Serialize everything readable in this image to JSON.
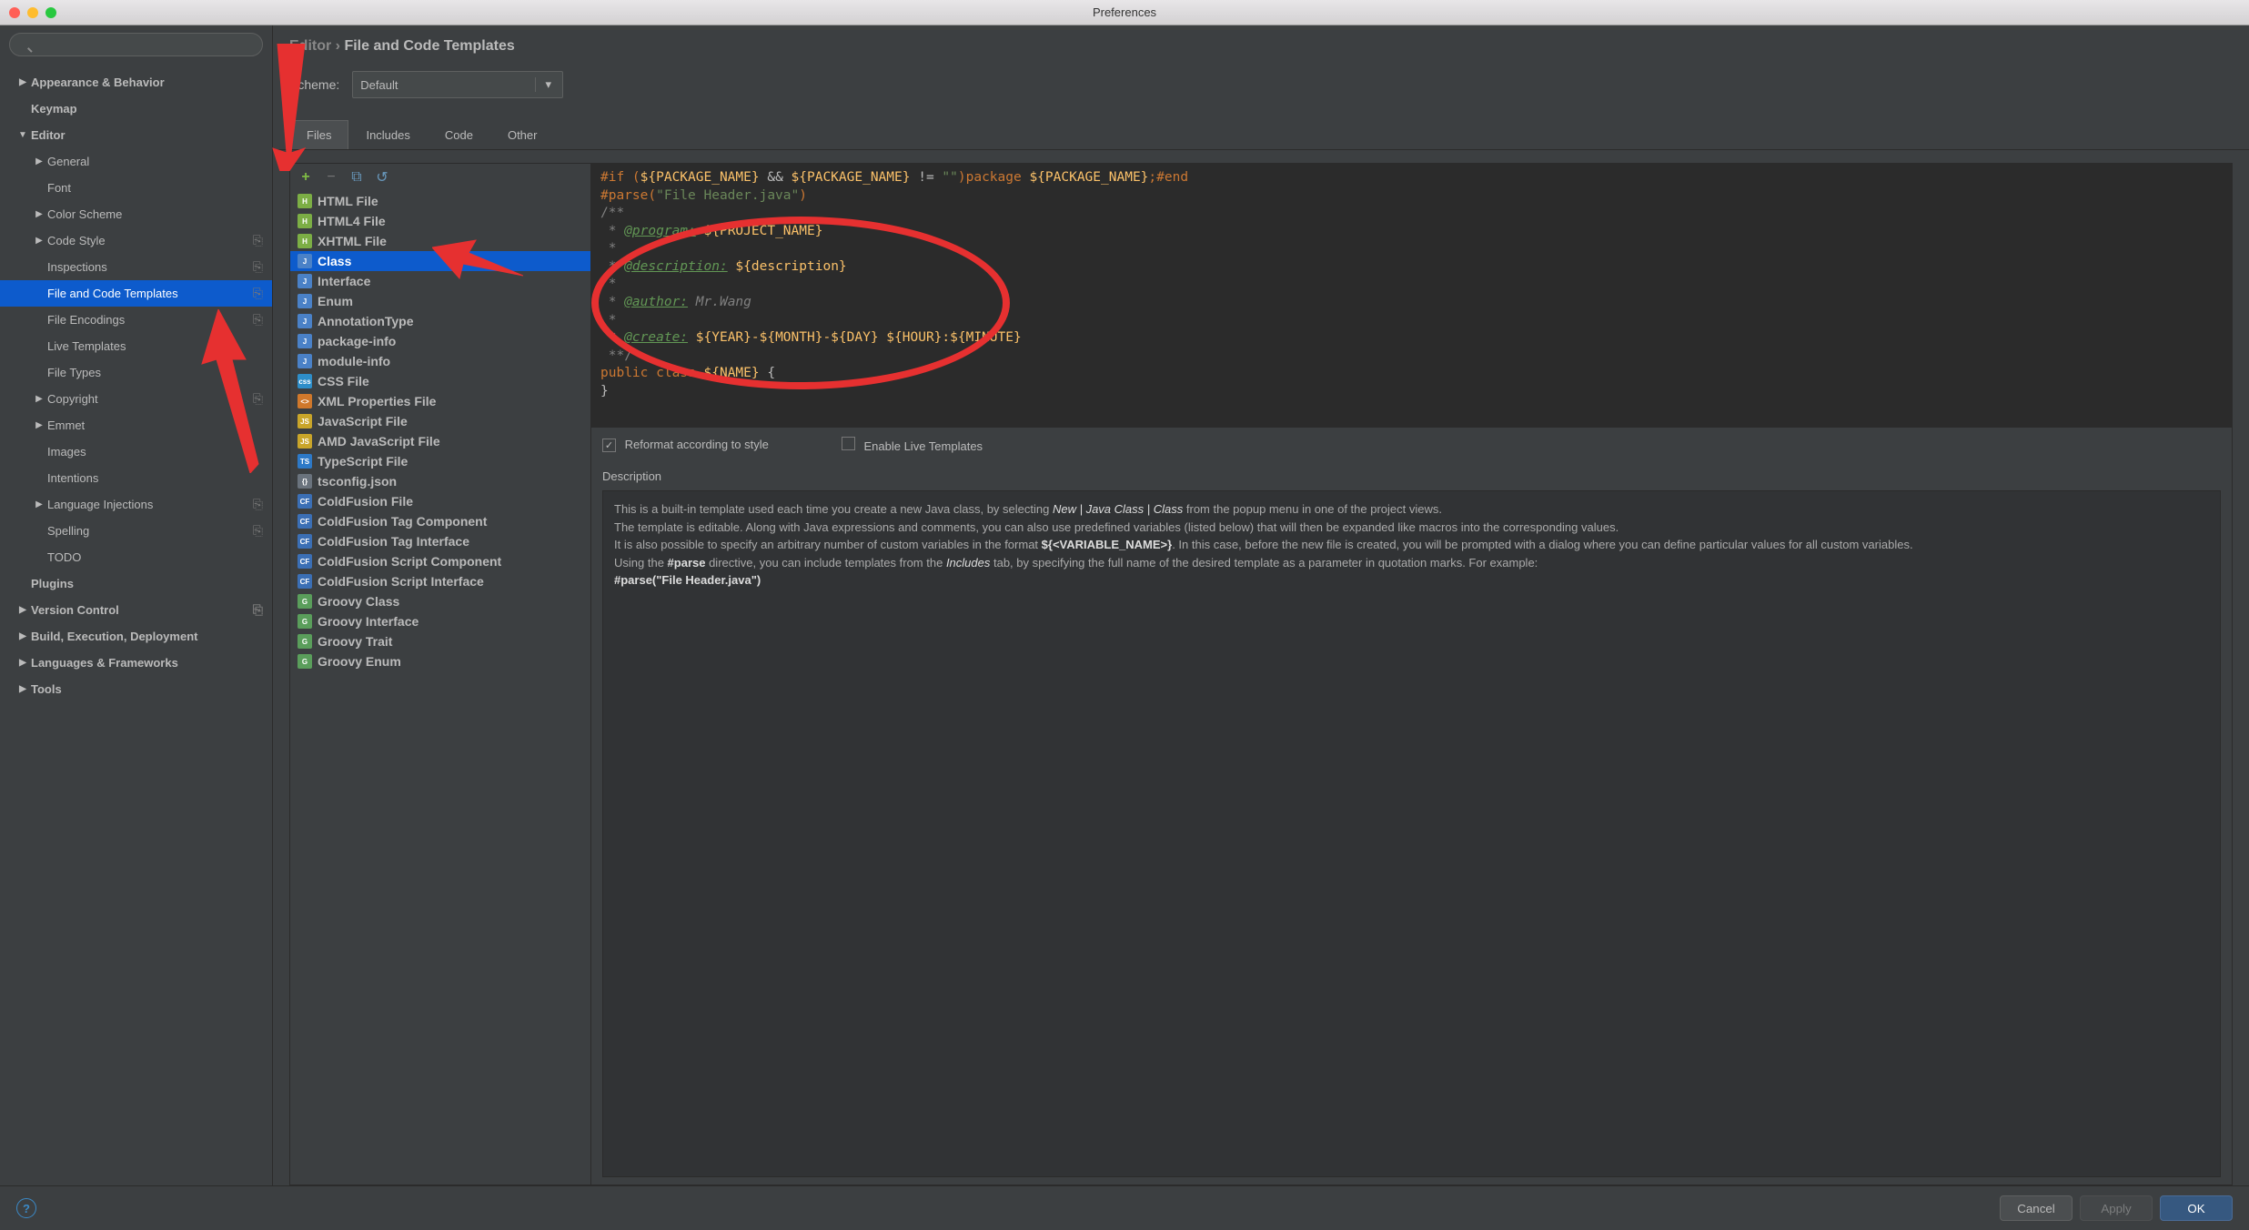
{
  "title": "Preferences",
  "sidebar": {
    "items": [
      {
        "label": "Appearance & Behavior",
        "arrow": "▶",
        "bold": true,
        "depth": 0
      },
      {
        "label": "Keymap",
        "arrow": "",
        "bold": true,
        "depth": 0
      },
      {
        "label": "Editor",
        "arrow": "▼",
        "bold": true,
        "depth": 0
      },
      {
        "label": "General",
        "arrow": "▶",
        "bold": false,
        "depth": 1
      },
      {
        "label": "Font",
        "arrow": "",
        "bold": false,
        "depth": 1
      },
      {
        "label": "Color Scheme",
        "arrow": "▶",
        "bold": false,
        "depth": 1
      },
      {
        "label": "Code Style",
        "arrow": "▶",
        "bold": false,
        "depth": 1,
        "badge": "⎘"
      },
      {
        "label": "Inspections",
        "arrow": "",
        "bold": false,
        "depth": 1,
        "badge": "⎘"
      },
      {
        "label": "File and Code Templates",
        "arrow": "",
        "bold": false,
        "depth": 1,
        "badge": "⎘",
        "selected": true
      },
      {
        "label": "File Encodings",
        "arrow": "",
        "bold": false,
        "depth": 1,
        "badge": "⎘"
      },
      {
        "label": "Live Templates",
        "arrow": "",
        "bold": false,
        "depth": 1
      },
      {
        "label": "File Types",
        "arrow": "",
        "bold": false,
        "depth": 1
      },
      {
        "label": "Copyright",
        "arrow": "▶",
        "bold": false,
        "depth": 1,
        "badge": "⎘"
      },
      {
        "label": "Emmet",
        "arrow": "▶",
        "bold": false,
        "depth": 1
      },
      {
        "label": "Images",
        "arrow": "",
        "bold": false,
        "depth": 1
      },
      {
        "label": "Intentions",
        "arrow": "",
        "bold": false,
        "depth": 1
      },
      {
        "label": "Language Injections",
        "arrow": "▶",
        "bold": false,
        "depth": 1,
        "badge": "⎘"
      },
      {
        "label": "Spelling",
        "arrow": "",
        "bold": false,
        "depth": 1,
        "badge": "⎘"
      },
      {
        "label": "TODO",
        "arrow": "",
        "bold": false,
        "depth": 1
      },
      {
        "label": "Plugins",
        "arrow": "",
        "bold": true,
        "depth": 0
      },
      {
        "label": "Version Control",
        "arrow": "▶",
        "bold": true,
        "depth": 0,
        "badge": "⎘"
      },
      {
        "label": "Build, Execution, Deployment",
        "arrow": "▶",
        "bold": true,
        "depth": 0
      },
      {
        "label": "Languages & Frameworks",
        "arrow": "▶",
        "bold": true,
        "depth": 0
      },
      {
        "label": "Tools",
        "arrow": "▶",
        "bold": true,
        "depth": 0
      }
    ]
  },
  "breadcrumb": {
    "parent": "Editor",
    "sep": "›",
    "current": "File and Code Templates"
  },
  "scheme": {
    "label": "Scheme:",
    "value": "Default"
  },
  "tabs": [
    "Files",
    "Includes",
    "Code",
    "Other"
  ],
  "activeTab": 0,
  "templates": [
    {
      "name": "HTML File",
      "iconBg": "#7cae45",
      "iconText": "H"
    },
    {
      "name": "HTML4 File",
      "iconBg": "#7cae45",
      "iconText": "H"
    },
    {
      "name": "XHTML File",
      "iconBg": "#7cae45",
      "iconText": "H"
    },
    {
      "name": "Class",
      "iconBg": "#4a81c7",
      "iconText": "J",
      "selected": true
    },
    {
      "name": "Interface",
      "iconBg": "#4a81c7",
      "iconText": "J"
    },
    {
      "name": "Enum",
      "iconBg": "#4a81c7",
      "iconText": "J"
    },
    {
      "name": "AnnotationType",
      "iconBg": "#4a81c7",
      "iconText": "J"
    },
    {
      "name": "package-info",
      "iconBg": "#4a81c7",
      "iconText": "J"
    },
    {
      "name": "module-info",
      "iconBg": "#4a81c7",
      "iconText": "J"
    },
    {
      "name": "CSS File",
      "iconBg": "#2e8ec9",
      "iconText": "css"
    },
    {
      "name": "XML Properties File",
      "iconBg": "#d0782b",
      "iconText": "<>"
    },
    {
      "name": "JavaScript File",
      "iconBg": "#c9a52a",
      "iconText": "JS"
    },
    {
      "name": "AMD JavaScript File",
      "iconBg": "#c9a52a",
      "iconText": "JS"
    },
    {
      "name": "TypeScript File",
      "iconBg": "#2d79c7",
      "iconText": "TS"
    },
    {
      "name": "tsconfig.json",
      "iconBg": "#6a737d",
      "iconText": "{}"
    },
    {
      "name": "ColdFusion File",
      "iconBg": "#3b6fb5",
      "iconText": "CF"
    },
    {
      "name": "ColdFusion Tag Component",
      "iconBg": "#3b6fb5",
      "iconText": "CF"
    },
    {
      "name": "ColdFusion Tag Interface",
      "iconBg": "#3b6fb5",
      "iconText": "CF"
    },
    {
      "name": "ColdFusion Script Component",
      "iconBg": "#3b6fb5",
      "iconText": "CF"
    },
    {
      "name": "ColdFusion Script Interface",
      "iconBg": "#3b6fb5",
      "iconText": "CF"
    },
    {
      "name": "Groovy Class",
      "iconBg": "#5a9e5b",
      "iconText": "G"
    },
    {
      "name": "Groovy Interface",
      "iconBg": "#5a9e5b",
      "iconText": "G"
    },
    {
      "name": "Groovy Trait",
      "iconBg": "#5a9e5b",
      "iconText": "G"
    },
    {
      "name": "Groovy Enum",
      "iconBg": "#5a9e5b",
      "iconText": "G"
    }
  ],
  "code": {
    "line1_pre": "#if (",
    "line1_v1": "${PACKAGE_NAME}",
    "line1_mid": " && ",
    "line1_v2": "${PACKAGE_NAME}",
    "line1_ne": " != ",
    "line1_empty": "\"\"",
    "line1_pkg": ")package ",
    "line1_v3": "${PACKAGE_NAME}",
    "line1_end": ";#end",
    "line2_pre": "#parse(",
    "line2_str": "\"File Header.java\"",
    "line2_end": ")",
    "doc_open": "/**",
    "star": " *",
    "program_tag": "@program:",
    "program_val": " ${PROJECT_NAME}",
    "desc_tag": "@description:",
    "desc_val": " ${description}",
    "author_tag": "@author:",
    "author_val": " Mr.Wang",
    "create_tag": "@create:",
    "create_val": " ${YEAR}-${MONTH}-${DAY} ${HOUR}:${MINUTE}",
    "doc_close": " **/",
    "cls_pre": "public class ",
    "cls_name": "${NAME}",
    "cls_open": " {",
    "cls_close": "}"
  },
  "checkboxes": {
    "reformat": {
      "checked": true,
      "label": "Reformat according to style"
    },
    "liveTemplates": {
      "checked": false,
      "label": "Enable Live Templates"
    }
  },
  "description": {
    "label": "Description",
    "p1a": "This is a built-in template used each time you create a new Java class, by selecting ",
    "p1b": "New | Java Class | Class",
    "p1c": " from the popup menu in one of the project views.",
    "p2": "The template is editable. Along with Java expressions and comments, you can also use predefined variables (listed below) that will then be expanded like macros into the corresponding values.",
    "p3a": "It is also possible to specify an arbitrary number of custom variables in the format ",
    "p3b": "${<VARIABLE_NAME>}",
    "p3c": ". In this case, before the new file is created, you will be prompted with a dialog where you can define particular values for all custom variables.",
    "p4a": "Using the ",
    "p4b": "#parse",
    "p4c": " directive, you can include templates from the ",
    "p4d": "Includes",
    "p4e": " tab, by specifying the full name of the desired template as a parameter in quotation marks. For example:",
    "p5": "#parse(\"File Header.java\")"
  },
  "buttons": {
    "cancel": "Cancel",
    "apply": "Apply",
    "ok": "OK"
  }
}
